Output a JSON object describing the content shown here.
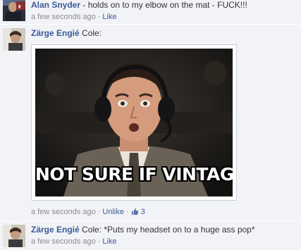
{
  "comments": [
    {
      "author": "Alan Snyder",
      "text": " - holds on to my elbow on the mat - FUCK!!!",
      "timestamp": "a few seconds ago",
      "action": "Like"
    },
    {
      "author": "Zärge Engié",
      "text": " Cole:",
      "timestamp": "a few seconds ago",
      "action": "Unlike",
      "like_count": "3",
      "photo": {
        "caption": "NOT SURE IF VINTAGE"
      }
    },
    {
      "author": "Zärge Engié",
      "text": " Cole: *Puts my headset on to a huge ass pop*",
      "timestamp": "a few seconds ago",
      "action": "Like"
    }
  ],
  "separator": "·",
  "colors": {
    "link": "#3b5998",
    "meta": "#8c8c8c",
    "background": "#edeff4"
  },
  "icons": {
    "like": "thumbs-up-icon"
  }
}
